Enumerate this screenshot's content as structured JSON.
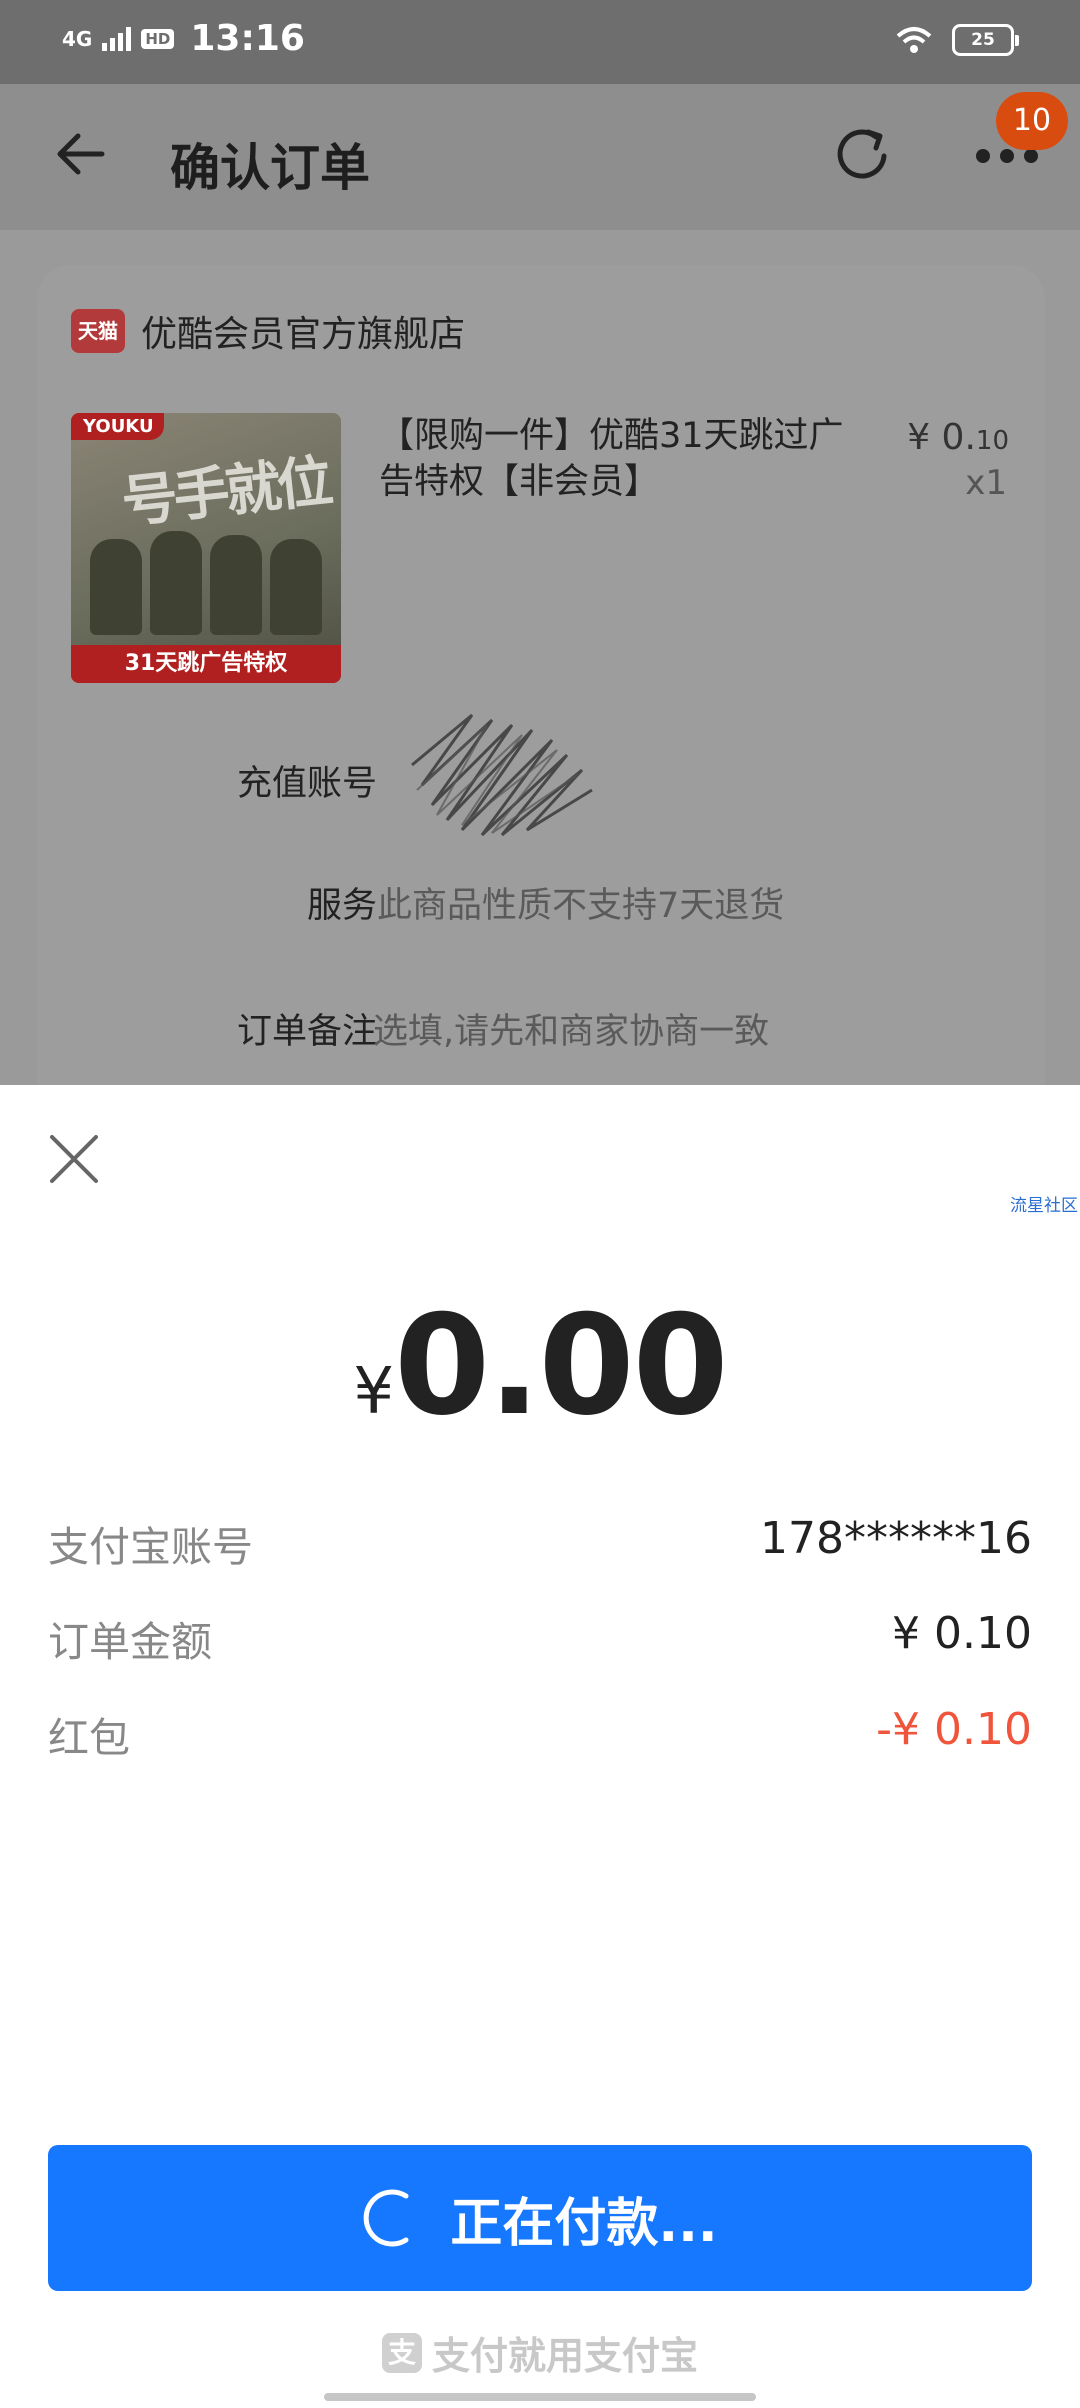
{
  "status_bar": {
    "network": "4G",
    "hd": "HD",
    "time": "13:16",
    "battery": "25"
  },
  "nav": {
    "title": "确认订单",
    "badge": "10"
  },
  "order": {
    "shop_logo": "天猫",
    "shop_name": "优酷会员官方旗舰店",
    "thumb": {
      "brand": "YOUKU",
      "art": "号手就位",
      "strip": "31天跳广告特权"
    },
    "product_title": "【限购一件】优酷31天跳过广告特权【非会员】",
    "price_symbol": "¥",
    "price_int": "0.",
    "price_dec": "10",
    "quantity": "x1",
    "account_label": "充值账号",
    "service_label": "服务",
    "service_value": "此商品性质不支持7天退货",
    "note_label": "订单备注",
    "note_placeholder": "选填,请先和商家协商一致"
  },
  "payment": {
    "watermark": "流星社区",
    "currency": "¥",
    "amount": "0.00",
    "rows": [
      {
        "label": "支付宝账号",
        "value": "178******16"
      },
      {
        "label": "订单金额",
        "value": "¥ 0.10"
      },
      {
        "label": "红包",
        "value": "-¥ 0.10"
      }
    ],
    "button_label": "正在付款...",
    "footer_logo": "支",
    "footer": "支付就用支付宝"
  },
  "colors": {
    "accent_blue": "#1677ff",
    "discount_red": "#f0553c",
    "badge_orange": "#d94c10"
  }
}
